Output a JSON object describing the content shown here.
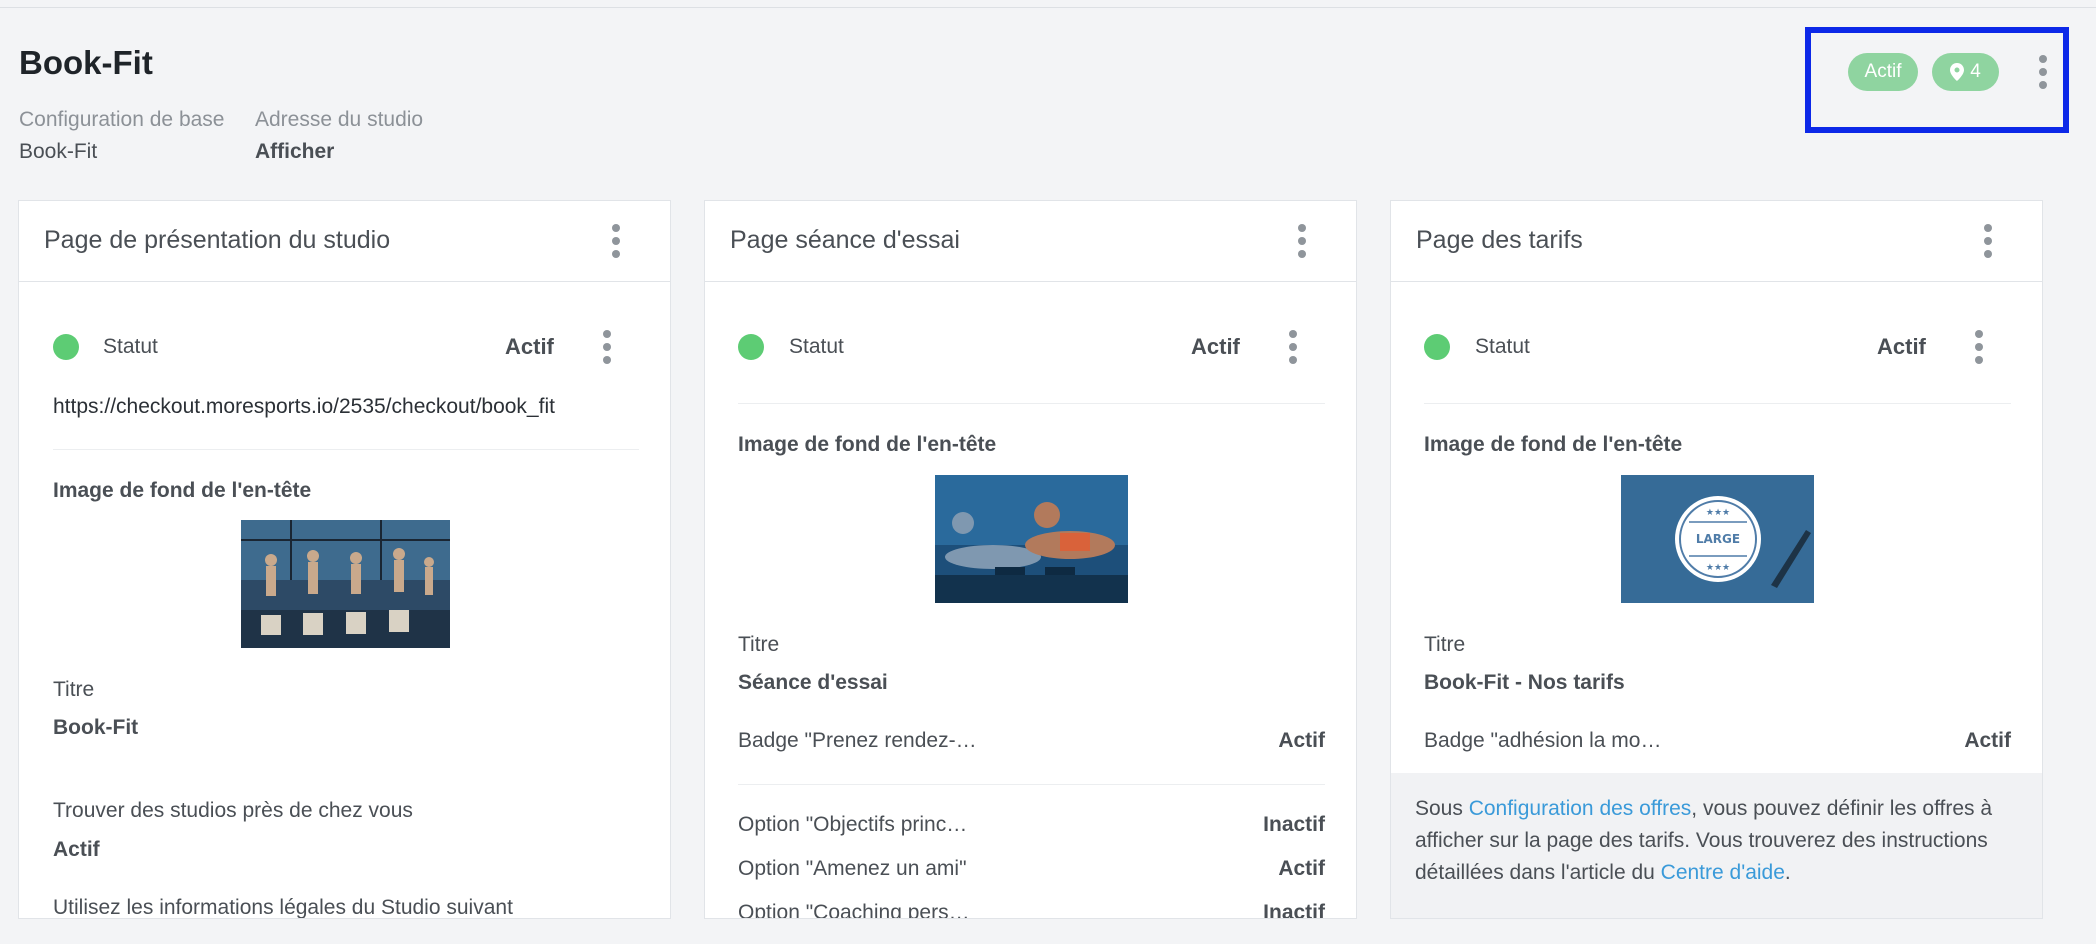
{
  "studio": {
    "title": "Book-Fit",
    "base_config_label": "Configuration de base",
    "base_config_value": "Book-Fit",
    "address_label": "Adresse du studio",
    "address_value": "Afficher",
    "status_badge": "Actif",
    "location_count": "4"
  },
  "cards": [
    {
      "title": "Page de présentation du studio",
      "status_label": "Statut",
      "status_value": "Actif",
      "url": "https://checkout.moresports.io/2535/checkout/book_fit",
      "image_label": "Image de fond de l'en-tête",
      "titre_label": "Titre",
      "titre_value": "Book-Fit",
      "finder_label": "Trouver des studios près de chez vous",
      "finder_value": "Actif",
      "legal_label": "Utilisez les informations légales du Studio suivant"
    },
    {
      "title": "Page séance d'essai",
      "status_label": "Statut",
      "status_value": "Actif",
      "image_label": "Image de fond de l'en-tête",
      "titre_label": "Titre",
      "titre_value": "Séance d'essai",
      "badge_label": "Badge \"Prenez rendez-…",
      "badge_value": "Actif",
      "options": [
        {
          "label": "Option \"Objectifs princ…",
          "value": "Inactif"
        },
        {
          "label": "Option \"Amenez un ami\"",
          "value": "Actif"
        },
        {
          "label": "Option \"Coaching pers…",
          "value": "Inactif"
        }
      ]
    },
    {
      "title": "Page des tarifs",
      "status_label": "Statut",
      "status_value": "Actif",
      "image_label": "Image de fond de l'en-tête",
      "image_badge_text": "LARGE",
      "image_badge_stars": "★★★",
      "titre_label": "Titre",
      "titre_value": "Book-Fit - Nos tarifs",
      "badge_label": "Badge \"adhésion la mo…",
      "badge_value": "Actif",
      "info": {
        "prefix": "Sous ",
        "link1": "Configuration des offres",
        "middle1": ", vous pouvez définir les offres à",
        "line2": "afficher sur la page des tarifs. Vous trouverez des instructions",
        "line3_prefix": "détaillées dans l'article du ",
        "link2": "Centre d'aide",
        "suffix": "."
      }
    }
  ],
  "colors": {
    "accent_link": "#3a9ad9",
    "status_green": "#5dcc74",
    "badge_green": "#8fd4a0",
    "highlight_blue": "#0c28e8"
  }
}
